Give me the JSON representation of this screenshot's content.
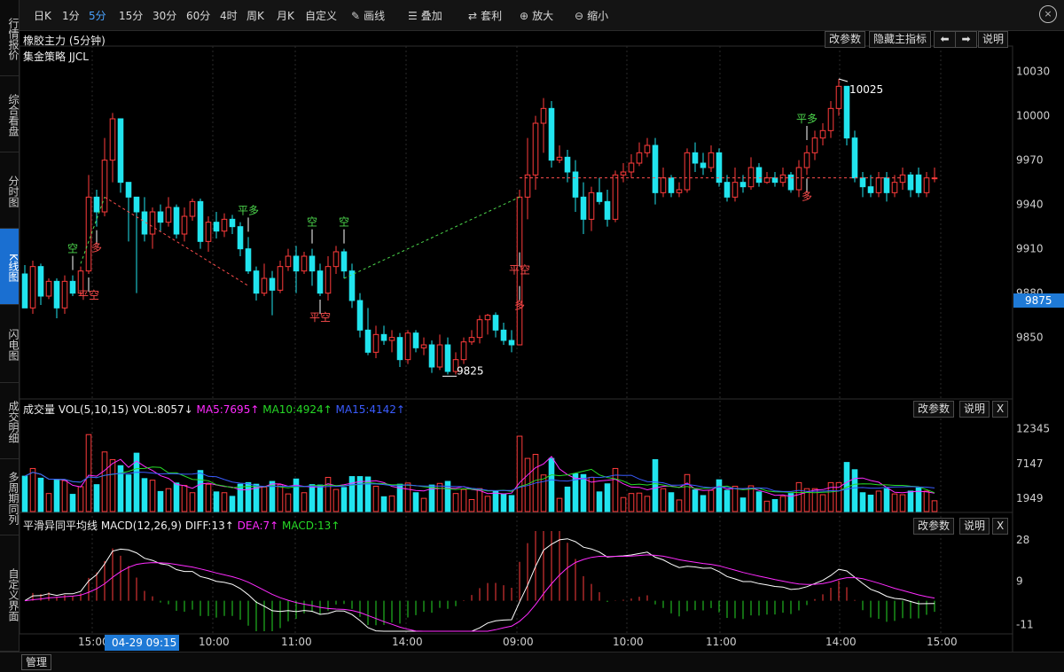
{
  "sidebar": {
    "items": [
      {
        "label": "行情报价",
        "active": false
      },
      {
        "label": "综合看盘",
        "active": false
      },
      {
        "label": "分时图",
        "active": false
      },
      {
        "label": "K线图",
        "active": true
      },
      {
        "label": "闪电图",
        "active": false
      },
      {
        "label": "成交明细",
        "active": false
      },
      {
        "label": "多周期同列",
        "active": false
      },
      {
        "label": "自定义界面",
        "active": false
      }
    ]
  },
  "toolbar": {
    "periods": [
      {
        "label": "日K",
        "active": false
      },
      {
        "label": "1分",
        "active": false
      },
      {
        "label": "5分",
        "active": true
      },
      {
        "label": "15分",
        "active": false
      },
      {
        "label": "30分",
        "active": false
      },
      {
        "label": "60分",
        "active": false
      },
      {
        "label": "4时",
        "active": false
      },
      {
        "label": "周K",
        "active": false
      },
      {
        "label": "月K",
        "active": false
      },
      {
        "label": "自定义",
        "active": false
      }
    ],
    "draw_label": "画线",
    "overlay_label": "叠加",
    "arbitrage_label": "套利",
    "zoom_in_label": "放大",
    "zoom_out_label": "缩小",
    "close_glyph": "×"
  },
  "main_panel": {
    "title": "橡胶主力 (5分钟)",
    "strategy_label": "集金策略 JJCL",
    "buttons": {
      "params": "改参数",
      "hide_indicator": "隐藏主指标",
      "explain": "说明"
    },
    "high_label": "10025",
    "low_label": "9825",
    "current_price": "9875"
  },
  "volume_panel": {
    "title": "成交量 VOL(5,10,15)",
    "vol": "VOL:8057↓",
    "ma5": "MA5:7695↑",
    "ma10": "MA10:4924↑",
    "ma15": "MA15:4142↑",
    "buttons": {
      "params": "改参数",
      "explain": "说明",
      "close": "X"
    },
    "axis": [
      "12345",
      "7147",
      "1949"
    ]
  },
  "macd_panel": {
    "title": "平滑异同平均线 MACD(12,26,9)",
    "diff": "DIFF:13↑",
    "dea": "DEA:7↑",
    "macd": "MACD:13↑",
    "buttons": {
      "params": "改参数",
      "explain": "说明",
      "close": "X"
    },
    "axis": [
      "28",
      "9",
      "-11"
    ]
  },
  "time_axis": {
    "labels": [
      "15:00",
      "10:00",
      "11:00",
      "14:00",
      "09:00",
      "10:00",
      "11:00",
      "14:00",
      "15:00"
    ],
    "cursor_time": "04-29 09:15"
  },
  "signals": [
    "空",
    "平空",
    "多",
    "平多",
    "空",
    "平空",
    "空",
    "平空",
    "多",
    "平多",
    "多"
  ],
  "colors": {
    "up": "#ff3b3b",
    "down": "#21e4ee",
    "ma5": "#ff2bff",
    "ma10": "#26d926",
    "ma15": "#3a5cff",
    "diff": "#ffffff",
    "dea": "#ff2bff",
    "signal_green": "#4cd64c",
    "signal_red": "#ff4d4d",
    "active_blue": "#1a6fd1"
  },
  "chart_data": {
    "type": "candlestick",
    "title": "橡胶主力 (5分钟)",
    "price_axis": [
      10030,
      10000,
      9970,
      9940,
      9910,
      9880,
      9850
    ],
    "ylim": [
      9815,
      10040
    ],
    "high": 10025,
    "low": 9825,
    "last": 9875,
    "candles": [
      [
        9893,
        9870,
        9899,
        9870
      ],
      [
        9870,
        9898,
        9902,
        9866
      ],
      [
        9898,
        9878,
        9900,
        9872
      ],
      [
        9878,
        9888,
        9890,
        9876
      ],
      [
        9888,
        9870,
        9890,
        9863
      ],
      [
        9870,
        9888,
        9892,
        9866
      ],
      [
        9888,
        9880,
        9892,
        9878
      ],
      [
        9880,
        9895,
        9898,
        9878
      ],
      [
        9895,
        9945,
        9960,
        9893
      ],
      [
        9945,
        9935,
        9950,
        9925
      ],
      [
        9935,
        9970,
        9985,
        9932
      ],
      [
        9970,
        9998,
        10002,
        9955
      ],
      [
        9998,
        9955,
        9980,
        9948
      ],
      [
        9955,
        9945,
        9952,
        9915
      ],
      [
        9945,
        9935,
        9944,
        9880
      ],
      [
        9935,
        9920,
        9945,
        9915
      ],
      [
        9920,
        9935,
        9938,
        9910
      ],
      [
        9935,
        9928,
        9940,
        9922
      ],
      [
        9928,
        9938,
        9945,
        9925
      ],
      [
        9938,
        9920,
        9940,
        9917
      ],
      [
        9920,
        9932,
        9938,
        9915
      ],
      [
        9932,
        9942,
        9944,
        9929
      ],
      [
        9942,
        9915,
        9944,
        9910
      ],
      [
        9915,
        9928,
        9932,
        9908
      ],
      [
        9928,
        9922,
        9935,
        9917
      ],
      [
        9922,
        9930,
        9934,
        9918
      ],
      [
        9930,
        9925,
        9933,
        9920
      ],
      [
        9925,
        9910,
        9928,
        9905
      ],
      [
        9910,
        9895,
        9918,
        9893
      ],
      [
        9895,
        9880,
        9898,
        9875
      ],
      [
        9880,
        9890,
        9900,
        9878
      ],
      [
        9890,
        9882,
        9895,
        9865
      ],
      [
        9882,
        9898,
        9902,
        9880
      ],
      [
        9898,
        9905,
        9910,
        9895
      ],
      [
        9905,
        9895,
        9912,
        9880
      ],
      [
        9895,
        9905,
        9908,
        9893
      ],
      [
        9905,
        9895,
        9910,
        9885
      ],
      [
        9895,
        9880,
        9900,
        9878
      ],
      [
        9880,
        9898,
        9905,
        9875
      ],
      [
        9898,
        9908,
        9912,
        9893
      ],
      [
        9908,
        9895,
        9910,
        9890
      ],
      [
        9895,
        9875,
        9900,
        9870
      ],
      [
        9875,
        9855,
        9880,
        9850
      ],
      [
        9855,
        9840,
        9870,
        9838
      ],
      [
        9840,
        9852,
        9858,
        9836
      ],
      [
        9852,
        9848,
        9858,
        9845
      ],
      [
        9848,
        9850,
        9855,
        9840
      ],
      [
        9850,
        9835,
        9853,
        9830
      ],
      [
        9835,
        9853,
        9855,
        9832
      ],
      [
        9853,
        9843,
        9855,
        9840
      ],
      [
        9843,
        9845,
        9850,
        9838
      ],
      [
        9845,
        9830,
        9848,
        9826
      ],
      [
        9830,
        9845,
        9852,
        9828
      ],
      [
        9845,
        9827,
        9850,
        9825
      ],
      [
        9827,
        9835,
        9840,
        9825
      ],
      [
        9835,
        9847,
        9850,
        9832
      ],
      [
        9847,
        9850,
        9855,
        9845
      ],
      [
        9850,
        9862,
        9865,
        9846
      ],
      [
        9862,
        9865,
        9866,
        9852
      ],
      [
        9865,
        9855,
        9867,
        9850
      ],
      [
        9855,
        9848,
        9860,
        9845
      ],
      [
        9848,
        9845,
        9855,
        9840
      ],
      [
        9845,
        9945,
        9950,
        9910
      ],
      [
        9945,
        9960,
        9985,
        9930
      ],
      [
        9960,
        9995,
        10000,
        9950
      ],
      [
        9995,
        10005,
        10012,
        9975
      ],
      [
        10005,
        9970,
        10010,
        9965
      ],
      [
        9970,
        9972,
        9980,
        9968
      ],
      [
        9972,
        9962,
        9977,
        9955
      ],
      [
        9962,
        9945,
        9970,
        9935
      ],
      [
        9945,
        9930,
        9955,
        9920
      ],
      [
        9930,
        9948,
        9952,
        9922
      ],
      [
        9948,
        9942,
        9958,
        9940
      ],
      [
        9942,
        9930,
        9950,
        9925
      ],
      [
        9930,
        9960,
        9963,
        9928
      ],
      [
        9960,
        9962,
        9968,
        9955
      ],
      [
        9962,
        9968,
        9974,
        9958
      ],
      [
        9968,
        9975,
        9982,
        9966
      ],
      [
        9975,
        9980,
        9985,
        9972
      ],
      [
        9980,
        9948,
        9985,
        9940
      ],
      [
        9948,
        9958,
        9965,
        9945
      ],
      [
        9958,
        9948,
        9960,
        9945
      ],
      [
        9948,
        9950,
        9955,
        9945
      ],
      [
        9950,
        9975,
        9978,
        9948
      ],
      [
        9975,
        9968,
        9982,
        9962
      ],
      [
        9968,
        9965,
        9975,
        9960
      ],
      [
        9965,
        9975,
        9980,
        9962
      ],
      [
        9975,
        9955,
        9978,
        9952
      ],
      [
        9955,
        9945,
        9960,
        9942
      ],
      [
        9945,
        9955,
        9965,
        9942
      ],
      [
        9955,
        9952,
        9960,
        9948
      ],
      [
        9952,
        9965,
        9972,
        9950
      ],
      [
        9965,
        9955,
        9968,
        9952
      ],
      [
        9955,
        9958,
        9962,
        9954
      ],
      [
        9958,
        9955,
        9962,
        9952
      ],
      [
        9955,
        9960,
        9965,
        9952
      ],
      [
        9960,
        9950,
        9962,
        9948
      ],
      [
        9950,
        9965,
        9970,
        9945
      ],
      [
        9965,
        9975,
        9980,
        9960
      ],
      [
        9975,
        9985,
        9990,
        9970
      ],
      [
        9985,
        9990,
        9995,
        9980
      ],
      [
        9990,
        10005,
        10010,
        9985
      ],
      [
        10005,
        10020,
        10025,
        10000
      ],
      [
        10020,
        9985,
        10020,
        9980
      ],
      [
        9985,
        9958,
        9990,
        9955
      ],
      [
        9958,
        9952,
        9962,
        9945
      ],
      [
        9952,
        9948,
        9960,
        9945
      ],
      [
        9948,
        9958,
        9962,
        9945
      ],
      [
        9958,
        9948,
        9962,
        9942
      ],
      [
        9948,
        9955,
        9960,
        9945
      ],
      [
        9955,
        9960,
        9965,
        9950
      ],
      [
        9960,
        9950,
        9962,
        9945
      ],
      [
        9960,
        9948,
        9965,
        9945
      ],
      [
        9948,
        9958,
        9962,
        9945
      ],
      [
        9958,
        9958,
        9965,
        9955
      ]
    ],
    "volume_axis": [
      12345,
      7147,
      1949
    ],
    "macd_axis": [
      28,
      9,
      -11
    ]
  }
}
